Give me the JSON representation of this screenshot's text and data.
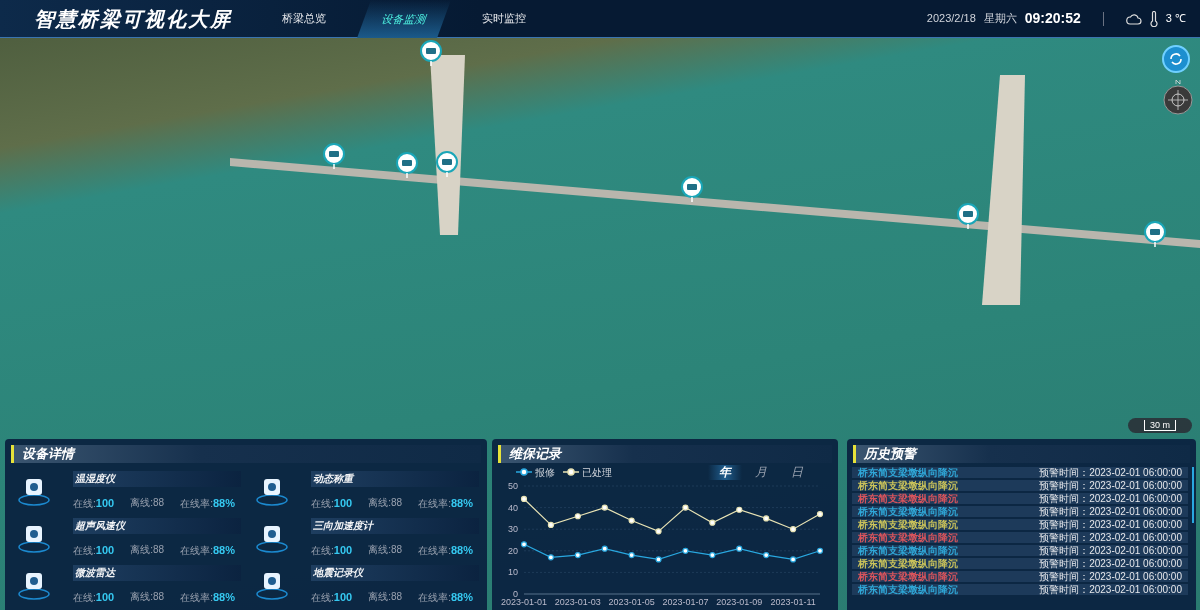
{
  "header": {
    "title": "智慧桥梁可视化大屏",
    "tabs": [
      {
        "label": "桥梁总览",
        "selected": false
      },
      {
        "label": "设备监测",
        "selected": true
      },
      {
        "label": "实时监控",
        "selected": false
      }
    ],
    "date": "2023/2/18",
    "weekday": "星期六",
    "time": "09:20:52",
    "temperature": "3 ℃"
  },
  "map": {
    "scale": "30 m"
  },
  "devices": {
    "title": "设备详情",
    "items": [
      {
        "name": "温湿度仪",
        "online_label": "在线:",
        "online": "100",
        "offline_label": "离线:",
        "offline": "88",
        "rate_label": "在线率:",
        "rate": "88%"
      },
      {
        "name": "动态称重",
        "online_label": "在线:",
        "online": "100",
        "offline_label": "离线:",
        "offline": "88",
        "rate_label": "在线率:",
        "rate": "88%"
      },
      {
        "name": "超声风速仪",
        "online_label": "在线:",
        "online": "100",
        "offline_label": "离线:",
        "offline": "88",
        "rate_label": "在线率:",
        "rate": "88%"
      },
      {
        "name": "三向加速度计",
        "online_label": "在线:",
        "online": "100",
        "offline_label": "离线:",
        "offline": "88",
        "rate_label": "在线率:",
        "rate": "88%"
      },
      {
        "name": "微波雷达",
        "online_label": "在线:",
        "online": "100",
        "offline_label": "离线:",
        "offline": "88",
        "rate_label": "在线率:",
        "rate": "88%"
      },
      {
        "name": "地震记录仪",
        "online_label": "在线:",
        "online": "100",
        "offline_label": "离线:",
        "offline": "88",
        "rate_label": "在线率:",
        "rate": "88%"
      }
    ]
  },
  "maintenance": {
    "title": "维保记录",
    "periods": [
      {
        "label": "年",
        "selected": true
      },
      {
        "label": "月",
        "selected": false
      },
      {
        "label": "日",
        "selected": false
      }
    ],
    "chart_data": {
      "type": "line",
      "categories": [
        "2023-01-01",
        null,
        "2023-01-03",
        null,
        "2023-01-05",
        null,
        "2023-01-07",
        null,
        "2023-01-09",
        null,
        "2023-01-11",
        null
      ],
      "ylim": [
        0,
        50
      ],
      "yticks": [
        0,
        10,
        20,
        30,
        40,
        50
      ],
      "grid": true,
      "series": [
        {
          "name": "报修",
          "color": "#29a8e0",
          "marker": "circle",
          "values": [
            23,
            17,
            18,
            21,
            18,
            16,
            20,
            18,
            21,
            18,
            16,
            20
          ]
        },
        {
          "name": "已处理",
          "color": "#e8e3b4",
          "marker": "circle",
          "values": [
            44,
            32,
            36,
            40,
            34,
            29,
            40,
            33,
            39,
            35,
            30,
            37
          ]
        }
      ]
    }
  },
  "alerts": {
    "title": "历史预警",
    "items": [
      {
        "text": "桥东简支梁墩纵向降沉",
        "color": "#2fa6d6",
        "time_label": "预警时间：",
        "time": "2023-02-01 06:00:00"
      },
      {
        "text": "桥东简支梁墩纵向降沉",
        "color": "#c9c25a",
        "time_label": "预警时间：",
        "time": "2023-02-01 06:00:00"
      },
      {
        "text": "桥东简支梁墩纵向降沉",
        "color": "#d9545c",
        "time_label": "预警时间：",
        "time": "2023-02-01 06:00:00"
      },
      {
        "text": "桥东简支梁墩纵向降沉",
        "color": "#2fa6d6",
        "time_label": "预警时间：",
        "time": "2023-02-01 06:00:00"
      },
      {
        "text": "桥东简支梁墩纵向降沉",
        "color": "#c9c25a",
        "time_label": "预警时间：",
        "time": "2023-02-01 06:00:00"
      },
      {
        "text": "桥东简支梁墩纵向降沉",
        "color": "#d9545c",
        "time_label": "预警时间：",
        "time": "2023-02-01 06:00:00"
      },
      {
        "text": "桥东简支梁墩纵向降沉",
        "color": "#2fa6d6",
        "time_label": "预警时间：",
        "time": "2023-02-01 06:00:00"
      },
      {
        "text": "桥东简支梁墩纵向降沉",
        "color": "#c9c25a",
        "time_label": "预警时间：",
        "time": "2023-02-01 06:00:00"
      },
      {
        "text": "桥东简支梁墩纵向降沉",
        "color": "#d9545c",
        "time_label": "预警时间：",
        "time": "2023-02-01 06:00:00"
      },
      {
        "text": "桥东简支梁墩纵向降沉",
        "color": "#2fa6d6",
        "time_label": "预警时间：",
        "time": "2023-02-01 06:00:00"
      }
    ]
  }
}
